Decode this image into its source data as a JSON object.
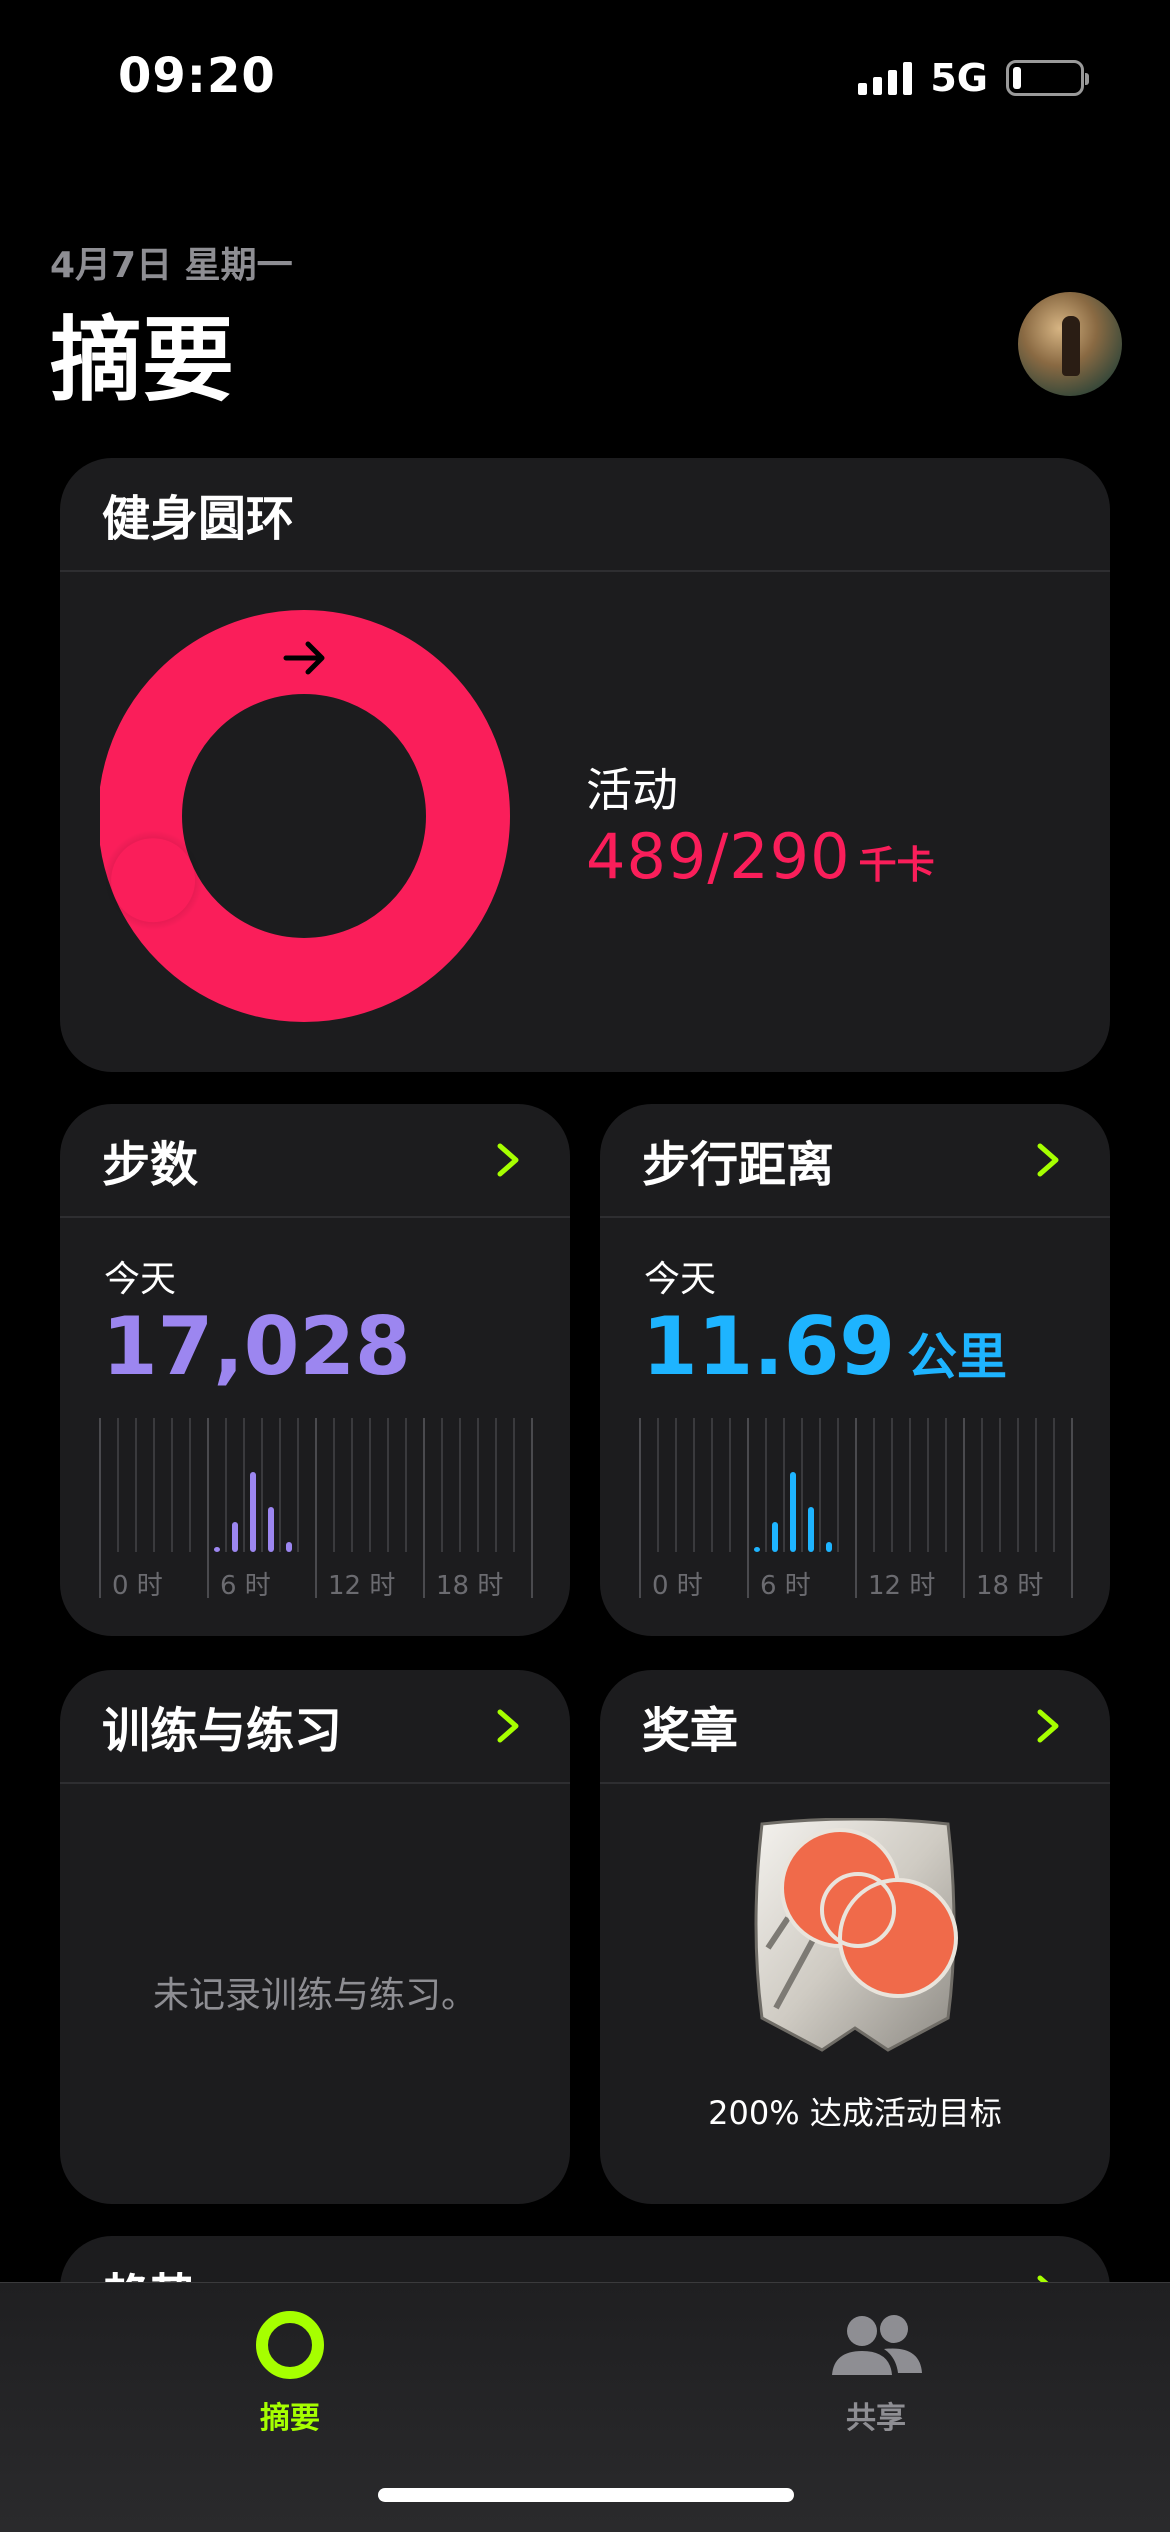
{
  "status_bar": {
    "time": "09:20",
    "network": "5G",
    "battery_level": 0.12
  },
  "header": {
    "date": "4月7日 星期一",
    "title": "摘要"
  },
  "rings": {
    "title": "健身圆环",
    "label": "活动",
    "value": "489/290",
    "unit": "千卡",
    "progress": 1.686,
    "color": "#FA1E5A"
  },
  "steps": {
    "title": "步数",
    "today_label": "今天",
    "value": "17,028",
    "color": "#9C86F0",
    "hourly_bars": [
      0,
      0,
      0,
      0,
      0,
      0,
      0.05,
      0.3,
      0.8,
      0.45,
      0.1,
      0,
      0,
      0,
      0,
      0,
      0,
      0,
      0,
      0,
      0,
      0,
      0,
      0
    ],
    "axis_labels": [
      "0 时",
      "6 时",
      "12 时",
      "18 时"
    ]
  },
  "distance": {
    "title": "步行距离",
    "today_label": "今天",
    "value": "11.69",
    "unit": "公里",
    "color": "#1EB4FF",
    "hourly_bars": [
      0,
      0,
      0,
      0,
      0,
      0,
      0.05,
      0.3,
      0.8,
      0.45,
      0.1,
      0,
      0,
      0,
      0,
      0,
      0,
      0,
      0,
      0,
      0,
      0,
      0,
      0
    ],
    "axis_labels": [
      "0 时",
      "6 时",
      "12 时",
      "18 时"
    ]
  },
  "workouts": {
    "title": "训练与练习",
    "empty_text": "未记录训练与练习。"
  },
  "awards": {
    "title": "奖章",
    "caption": "200% 达成活动目标"
  },
  "trends": {
    "title": "趋势"
  },
  "tabbar": {
    "tabs": [
      {
        "label": "摘要",
        "active": true,
        "icon": "activity-ring-icon"
      },
      {
        "label": "共享",
        "active": false,
        "icon": "people-icon"
      }
    ],
    "active_color": "#A6FF00",
    "inactive_color": "#8E8E93"
  }
}
